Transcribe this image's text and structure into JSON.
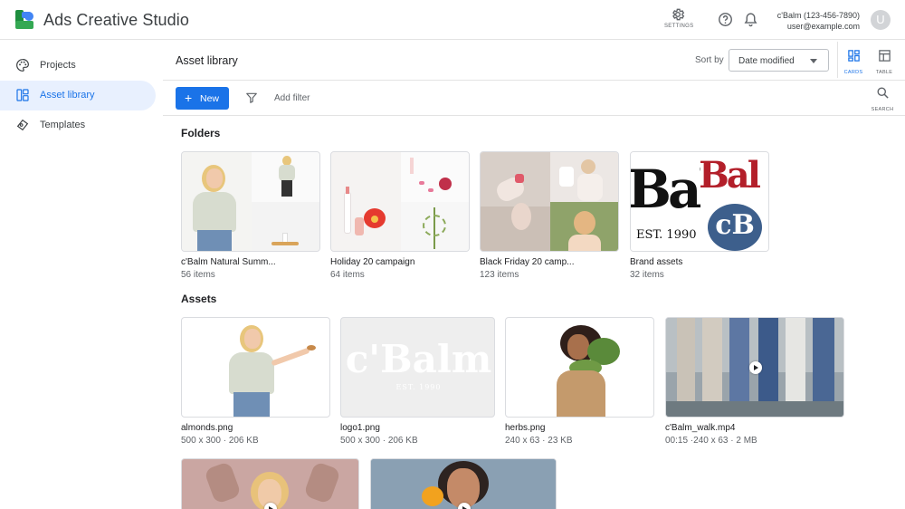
{
  "app": {
    "title": "Ads Creative Studio"
  },
  "header": {
    "settings_label": "SETTINGS",
    "account_name": "c'Balm (123-456-7890)",
    "account_email": "user@example.com",
    "avatar_initial": "U"
  },
  "sidebar": {
    "items": [
      {
        "label": "Projects",
        "icon": "palette-icon",
        "active": false
      },
      {
        "label": "Asset library",
        "icon": "library-icon",
        "active": true
      },
      {
        "label": "Templates",
        "icon": "template-icon",
        "active": false
      }
    ]
  },
  "main": {
    "title": "Asset library",
    "sort_label": "Sort by",
    "sort_value": "Date modified",
    "view_cards_label": "CARDS",
    "view_table_label": "TABLE",
    "search_label": "SEARCH",
    "new_label": "New",
    "add_filter_label": "Add filter"
  },
  "folders": {
    "title": "Folders",
    "items": [
      {
        "name": "c'Balm Natural Summ...",
        "count": "56 items"
      },
      {
        "name": "Holiday 20 campaign",
        "count": "64 items"
      },
      {
        "name": "Black Friday 20 camp...",
        "count": "123 items"
      },
      {
        "name": "Brand assets",
        "count": "32 items"
      }
    ]
  },
  "assets": {
    "title": "Assets",
    "items": [
      {
        "name": "almonds.png",
        "meta": "500 x 300 · 206 KB",
        "type": "image"
      },
      {
        "name": "logo1.png",
        "meta": "500 x 300 · 206 KB",
        "type": "image",
        "logo_text": "c'Balm",
        "logo_sub": "EST. 1990"
      },
      {
        "name": "herbs.png",
        "meta": "240 x 63 · 23 KB",
        "type": "image"
      },
      {
        "name": "c'Balm_walk.mp4",
        "meta": "00:15 ·240 x 63 · 2 MB",
        "type": "video"
      },
      {
        "name": "",
        "meta": "",
        "type": "video"
      },
      {
        "name": "",
        "meta": "",
        "type": "video"
      }
    ]
  },
  "brand_tile": {
    "text_a": "Bal",
    "text_b": "Bal",
    "text_est": "EST. 1990",
    "monogram": "cB"
  },
  "colors": {
    "accent": "#1a73e8",
    "active_nav_bg": "#e8f0fe",
    "brand_red": "#b31f2a",
    "brand_blue": "#3d5f8c"
  }
}
